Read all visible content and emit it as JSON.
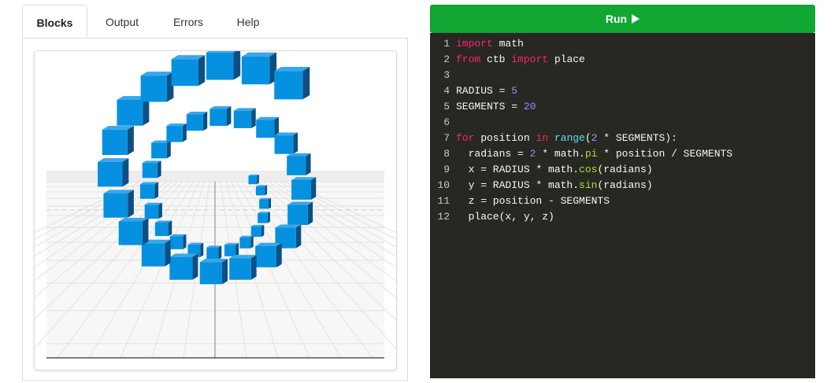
{
  "tabs": [
    {
      "label": "Blocks",
      "active": true
    },
    {
      "label": "Output",
      "active": false
    },
    {
      "label": "Errors",
      "active": false
    },
    {
      "label": "Help",
      "active": false
    }
  ],
  "run_button": {
    "label": "Run",
    "icon": "play-icon"
  },
  "colors": {
    "run_green": "#10a832",
    "editor_bg": "#272822",
    "keyword": "#f92672",
    "number": "#ae81ff",
    "builtin": "#66d9ef",
    "attribute": "#a6e22e",
    "cube_front": "#0590e0",
    "cube_side": "#0e4f82"
  },
  "code": {
    "line_numbers": [
      "1",
      "2",
      "3",
      "4",
      "5",
      "6",
      "7",
      "8",
      "9",
      "10",
      "11",
      "12"
    ],
    "lines": [
      [
        {
          "t": "import",
          "c": "kw"
        },
        {
          "t": " math",
          "c": "id"
        }
      ],
      [
        {
          "t": "from",
          "c": "kw"
        },
        {
          "t": " ctb ",
          "c": "id"
        },
        {
          "t": "import",
          "c": "kw"
        },
        {
          "t": " place",
          "c": "id"
        }
      ],
      [],
      [
        {
          "t": "RADIUS = ",
          "c": "id"
        },
        {
          "t": "5",
          "c": "num"
        }
      ],
      [
        {
          "t": "SEGMENTS = ",
          "c": "id"
        },
        {
          "t": "20",
          "c": "num"
        }
      ],
      [],
      [
        {
          "t": "for",
          "c": "kw"
        },
        {
          "t": " position ",
          "c": "id"
        },
        {
          "t": "in",
          "c": "kw"
        },
        {
          "t": " ",
          "c": "id"
        },
        {
          "t": "range",
          "c": "fn"
        },
        {
          "t": "(",
          "c": "id"
        },
        {
          "t": "2",
          "c": "num"
        },
        {
          "t": " * SEGMENTS):",
          "c": "id"
        }
      ],
      [
        {
          "t": "  radians = ",
          "c": "id"
        },
        {
          "t": "2",
          "c": "num"
        },
        {
          "t": " * math.",
          "c": "id"
        },
        {
          "t": "pi",
          "c": "attr"
        },
        {
          "t": " * position / SEGMENTS",
          "c": "id"
        }
      ],
      [
        {
          "t": "  x = RADIUS * math.",
          "c": "id"
        },
        {
          "t": "cos",
          "c": "attr"
        },
        {
          "t": "(radians)",
          "c": "id"
        }
      ],
      [
        {
          "t": "  y = RADIUS * math.",
          "c": "id"
        },
        {
          "t": "sin",
          "c": "attr"
        },
        {
          "t": "(radians)",
          "c": "id"
        }
      ],
      [
        {
          "t": "  z = position - SEGMENTS",
          "c": "id"
        }
      ],
      [
        {
          "t": "  place(x, y, z)",
          "c": "id"
        }
      ]
    ]
  }
}
